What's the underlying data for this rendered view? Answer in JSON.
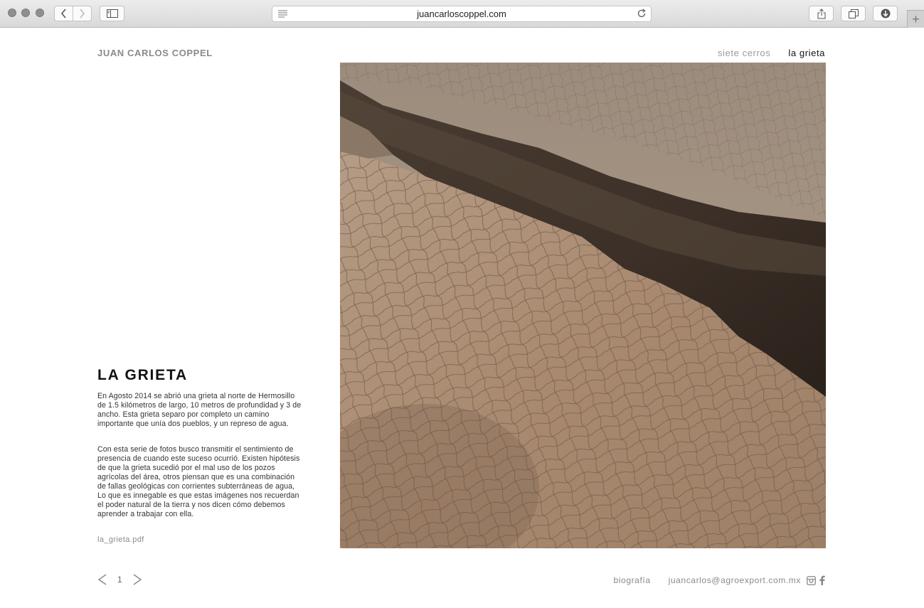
{
  "browser": {
    "url": "juancarloscoppel.com"
  },
  "site": {
    "title": "JUAN CARLOS COPPEL",
    "nav": [
      {
        "label": "siete cerros",
        "active": false
      },
      {
        "label": "la grieta",
        "active": true
      }
    ]
  },
  "project": {
    "title": "LA GRIETA",
    "paragraphs": [
      "En Agosto 2014 se abrió una grieta al norte de Hermosillo de 1.5 kilómetros de largo, 10 metros de profundidad y 3 de ancho. Esta grieta separo por completo un camino importante que unía dos pueblos, y un represo de agua.",
      "Con esta serie de fotos busco transmitir el sentimiento de presencia de cuando este suceso ocurrió. Existen hipótesis de que la grieta sucedió por el mal uso de los pozos agrícolas del área, otros piensan que es una combinación de fallas geológicas con corrientes subterráneas de agua, Lo que es innegable es que estas imágenes nos recuerdan el poder natural de la tierra y nos dicen cómo debemos aprender a trabajar con ella."
    ],
    "pdf_link": "la_grieta.pdf"
  },
  "pager": {
    "current": "1"
  },
  "footer": {
    "bio_label": "biografía",
    "email": "juancarlos@agroexport.com.mx"
  },
  "icons": {
    "photo": "cracked-earth-photo",
    "social": [
      "instagram-icon",
      "facebook-icon"
    ]
  }
}
